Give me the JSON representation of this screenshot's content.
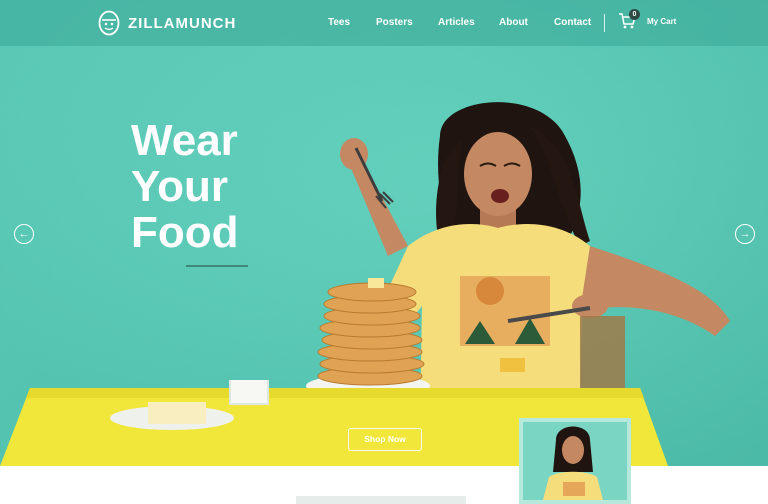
{
  "brand": {
    "name": "ZILLAMUNCH",
    "accent": "#57cdb8"
  },
  "nav": {
    "items": [
      "Tees",
      "Posters",
      "Articles",
      "About",
      "Contact"
    ],
    "cart_label": "My Cart",
    "cart_count": "0"
  },
  "hero": {
    "headline": [
      "Wear",
      "Your",
      "Food"
    ],
    "cta_label": "Shop Now",
    "prev_icon": "arrow-left-icon",
    "next_icon": "arrow-right-icon"
  }
}
